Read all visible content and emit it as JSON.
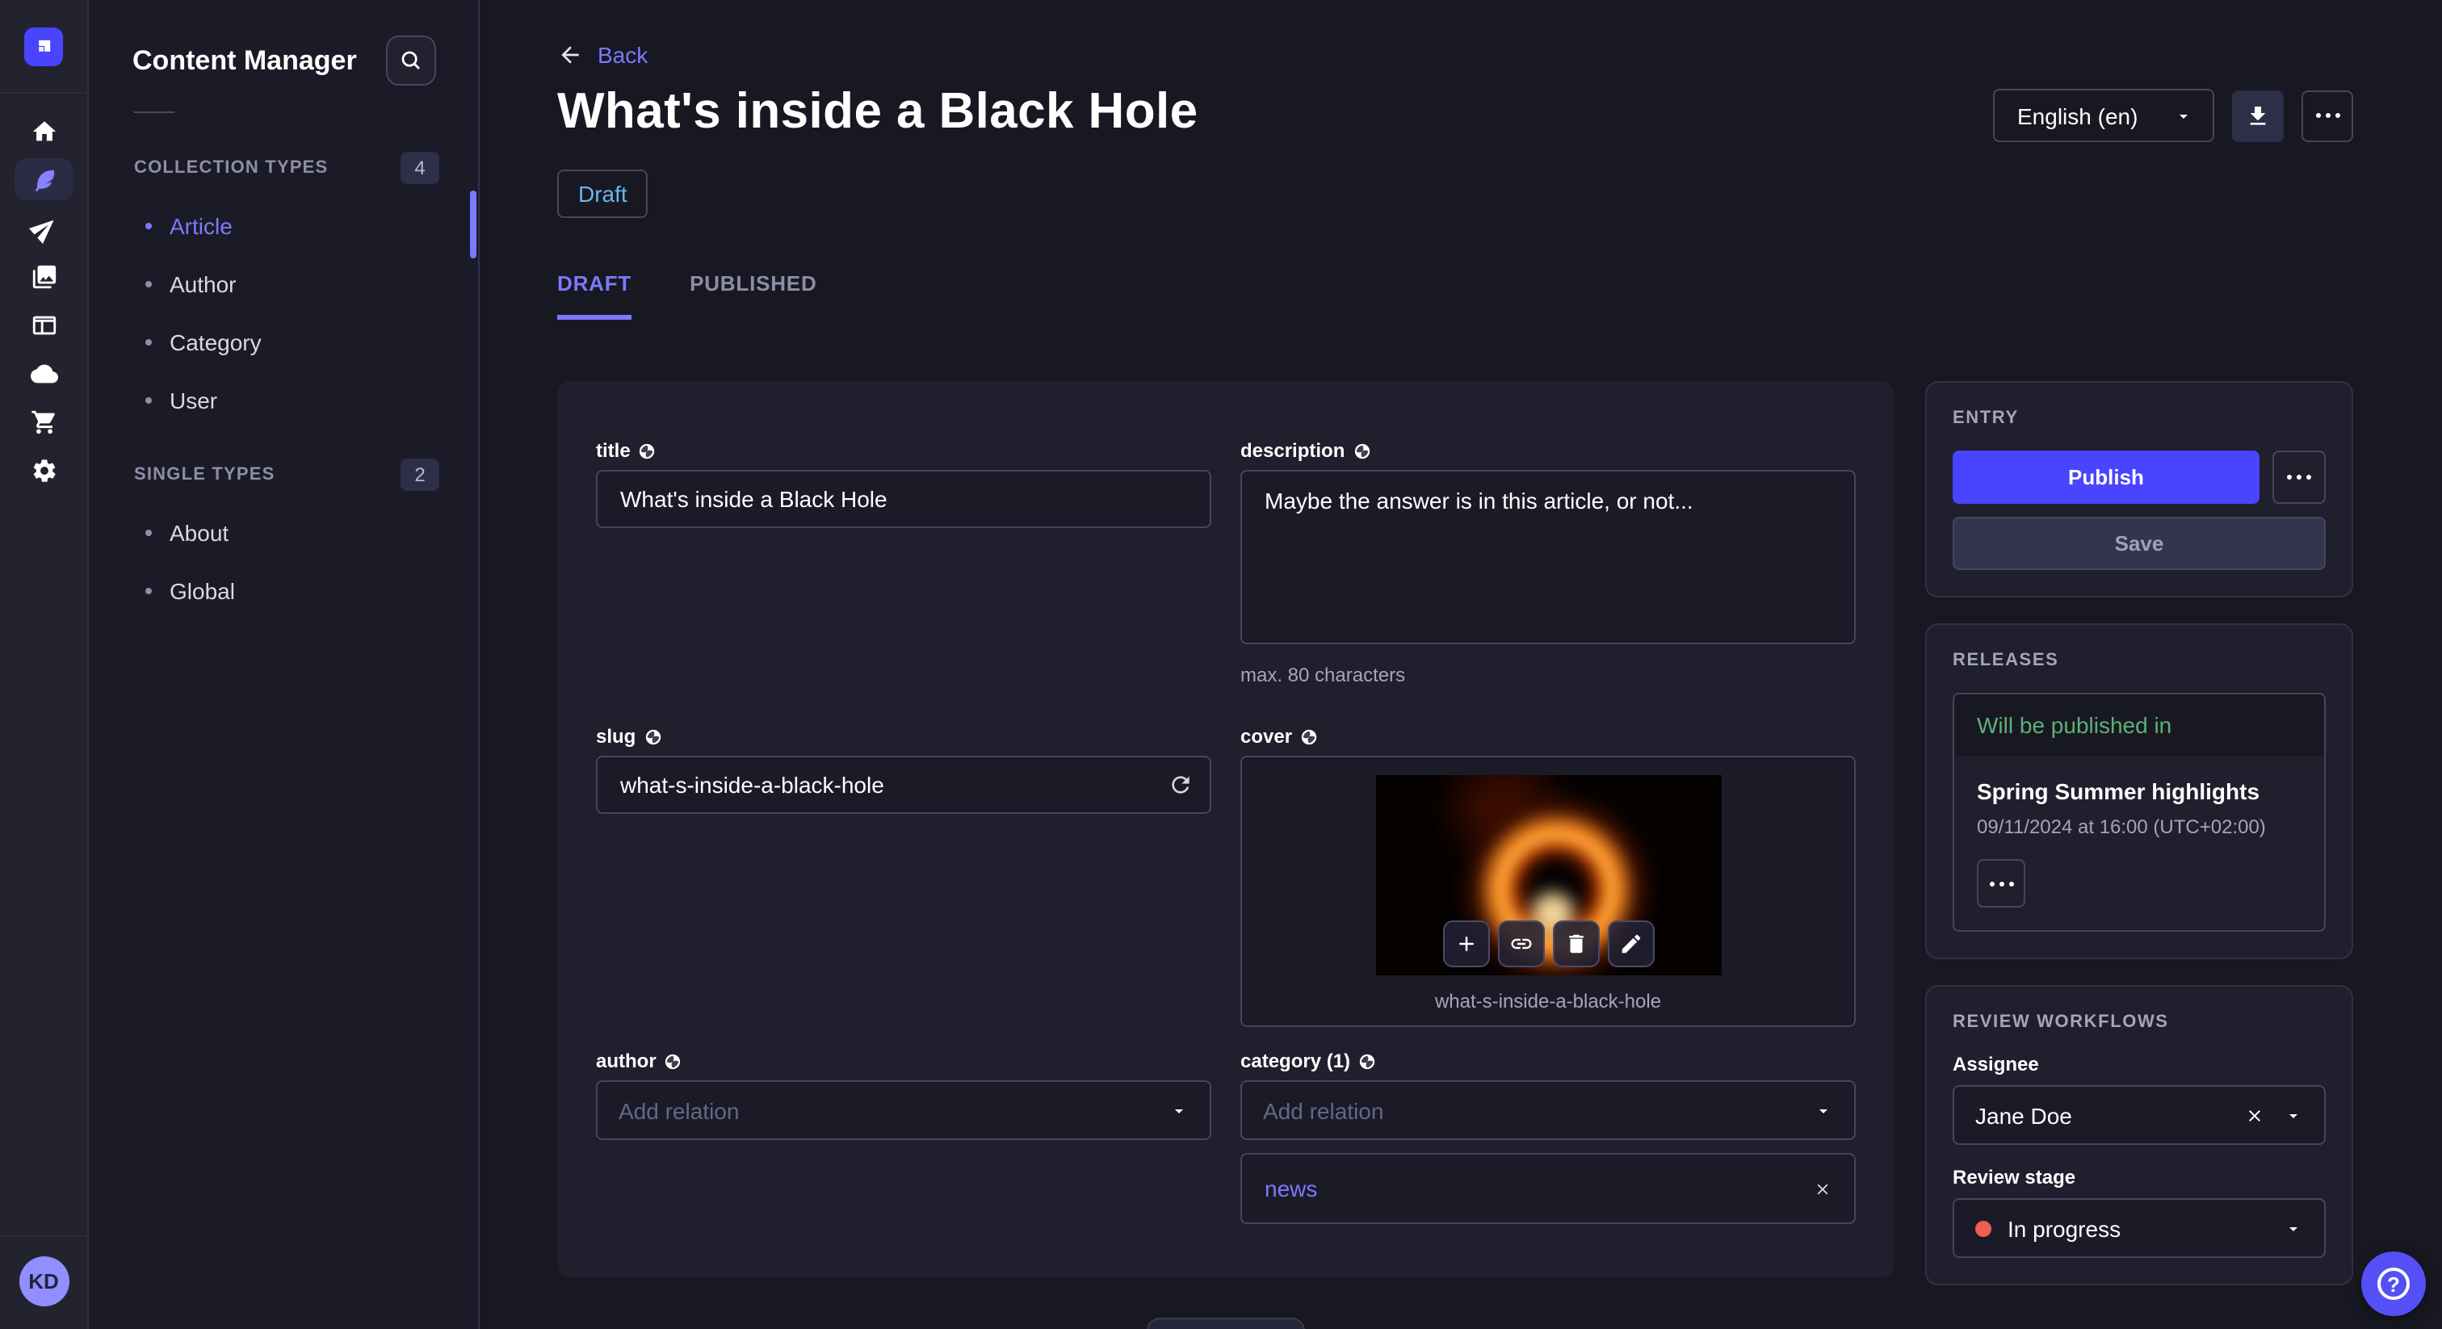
{
  "colors": {
    "accent": "#4945ff",
    "link_purple": "#7b79ff",
    "draft_blue": "#66b7f1",
    "success_green": "#5cb176",
    "danger_red": "#ee5e52",
    "page_bg": "#181822",
    "card_bg": "#1f1f2d"
  },
  "mainnav": {
    "icons": [
      "strapi-logo-icon",
      "home-icon",
      "feather-icon",
      "paper-plane-icon",
      "images-icon",
      "layout-icon",
      "cloud-icon",
      "cart-icon",
      "gear-icon"
    ],
    "avatar_initials": "KD"
  },
  "subnav": {
    "title": "Content Manager",
    "search_icon": "magnifier",
    "sections": [
      {
        "label": "COLLECTION TYPES",
        "count": "4",
        "items": [
          {
            "label": "Article"
          },
          {
            "label": "Author"
          },
          {
            "label": "Category"
          },
          {
            "label": "User"
          }
        ]
      },
      {
        "label": "SINGLE TYPES",
        "count": "2",
        "items": [
          {
            "label": "About"
          },
          {
            "label": "Global"
          }
        ]
      }
    ]
  },
  "header": {
    "back_label": "Back",
    "title": "What's inside a Black Hole",
    "status": "Draft",
    "tabs": [
      {
        "label": "DRAFT"
      },
      {
        "label": "PUBLISHED"
      }
    ],
    "locale": "English (en)"
  },
  "form": {
    "title": {
      "label": "title",
      "value": "What's inside a Black Hole"
    },
    "description": {
      "label": "description",
      "value": "Maybe the answer is in this article, or not...",
      "hint": "max. 80 characters"
    },
    "slug": {
      "label": "slug",
      "value": "what-s-inside-a-black-hole"
    },
    "cover": {
      "label": "cover",
      "caption": "what-s-inside-a-black-hole",
      "toolbar_icons": [
        "plus-icon",
        "link-icon",
        "trash-icon",
        "pencil-icon"
      ]
    },
    "author": {
      "label": "author",
      "placeholder": "Add relation"
    },
    "category": {
      "label": "category (1)",
      "placeholder": "Add relation",
      "selected_relation": "news"
    }
  },
  "entry_panel": {
    "heading": "ENTRY",
    "publish_label": "Publish",
    "save_label": "Save"
  },
  "releases_panel": {
    "heading": "RELEASES",
    "status_text": "Will be published in",
    "release_name": "Spring Summer highlights",
    "release_date": "09/11/2024 at 16:00 (UTC+02:00)"
  },
  "review_panel": {
    "heading": "REVIEW WORKFLOWS",
    "assignee_label": "Assignee",
    "assignee_value": "Jane Doe",
    "stage_label": "Review stage",
    "stage_value": "In progress"
  },
  "help": {
    "icon": "question-mark-icon"
  }
}
